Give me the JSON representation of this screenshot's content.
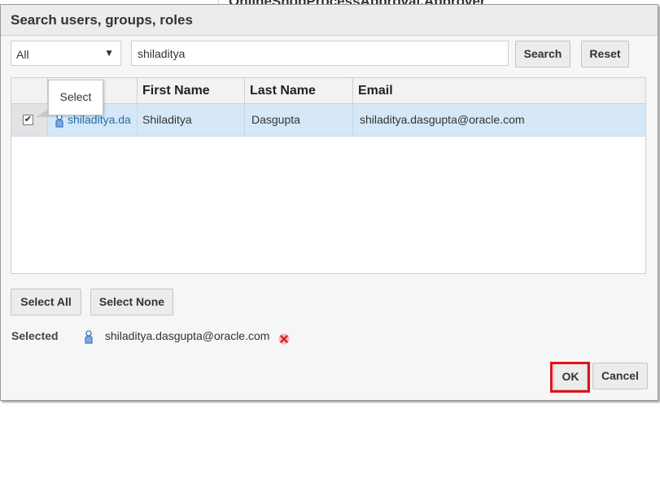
{
  "background": {
    "heading": "OnlineShopProcessApproval.Approver"
  },
  "dialog": {
    "title": "Search users, groups, roles"
  },
  "search": {
    "scope_value": "All",
    "query_value": "shiladitya",
    "search_label": "Search",
    "reset_label": "Reset"
  },
  "table": {
    "columns": [
      "",
      "First Name",
      "Last Name",
      "Email"
    ],
    "rows": [
      {
        "selected": true,
        "user": "shiladitya.da",
        "first_name": "Shiladitya",
        "last_name": "Dasgupta",
        "email": "shiladitya.dasgupta@oracle.com"
      }
    ]
  },
  "tooltip": {
    "text": "Select"
  },
  "selection_buttons": {
    "select_all": "Select All",
    "select_none": "Select None"
  },
  "selected": {
    "label": "Selected",
    "value": "shiladitya.dasgupta@oracle.com",
    "icon": "person-icon",
    "remove_icon": "remove-icon"
  },
  "footer": {
    "ok_label": "OK",
    "cancel_label": "Cancel"
  },
  "colors": {
    "highlight": "#e0121b",
    "row_selected": "#d6e8f8",
    "link": "#1f6fa8"
  }
}
